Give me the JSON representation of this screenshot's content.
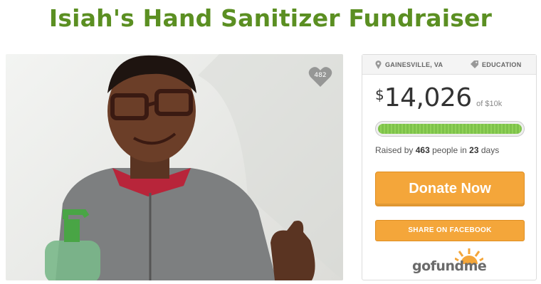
{
  "page": {
    "title": "Isiah's Hand Sanitizer Fundraiser"
  },
  "photo": {
    "likes": "482",
    "icon": "heart-icon"
  },
  "campaign": {
    "location": "GAINESVILLE, VA",
    "location_icon": "map-pin-icon",
    "category": "EDUCATION",
    "category_icon": "tag-icon",
    "currency_symbol": "$",
    "amount_raised": "14,026",
    "goal_text": "of $10k",
    "progress_fraction": 1.0,
    "raised_prefix": "Raised by",
    "donor_count": "463",
    "raised_middle": "people in",
    "days": "23",
    "raised_suffix": "days"
  },
  "actions": {
    "donate_label": "Donate Now",
    "share_label": "SHARE ON FACEBOOK"
  },
  "brand": {
    "logo_text": "gofundme",
    "colors": {
      "green": "#5b8f22",
      "orange": "#f4a63a",
      "progress": "#7ec24a"
    }
  }
}
